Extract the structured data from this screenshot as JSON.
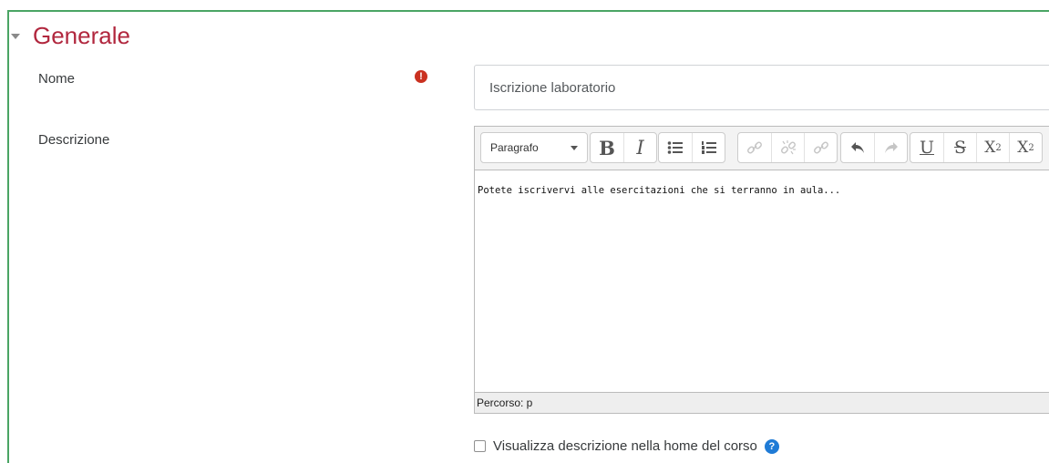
{
  "section": {
    "title": "Generale"
  },
  "form": {
    "name_label": "Nome",
    "name_value": "Iscrizione laboratorio",
    "description_label": "Descrizione",
    "display_checkbox_label": "Visualizza descrizione nella home del corso"
  },
  "editor": {
    "paragraph_select": "Paragrafo",
    "content": "Potete iscrivervi alle esercitazioni che si terranno in aula...",
    "path": "Percorso: p",
    "toolbar": {
      "bold": "B",
      "italic": "I",
      "underline": "U",
      "strike": "S",
      "subscript_base": "X",
      "subscript_mark": "2",
      "superscript_base": "X",
      "superscript_mark": "2"
    }
  },
  "colors": {
    "section_title": "#b1273e",
    "required": "#ca3120",
    "help": "#1f7bd6",
    "frame_border": "#4aa564"
  },
  "icons": [
    "collapse-caret-icon",
    "required-icon",
    "unordered-list-icon",
    "ordered-list-icon",
    "link-icon",
    "unlink-icon",
    "manage-links-icon",
    "undo-icon",
    "redo-icon",
    "help-icon"
  ]
}
